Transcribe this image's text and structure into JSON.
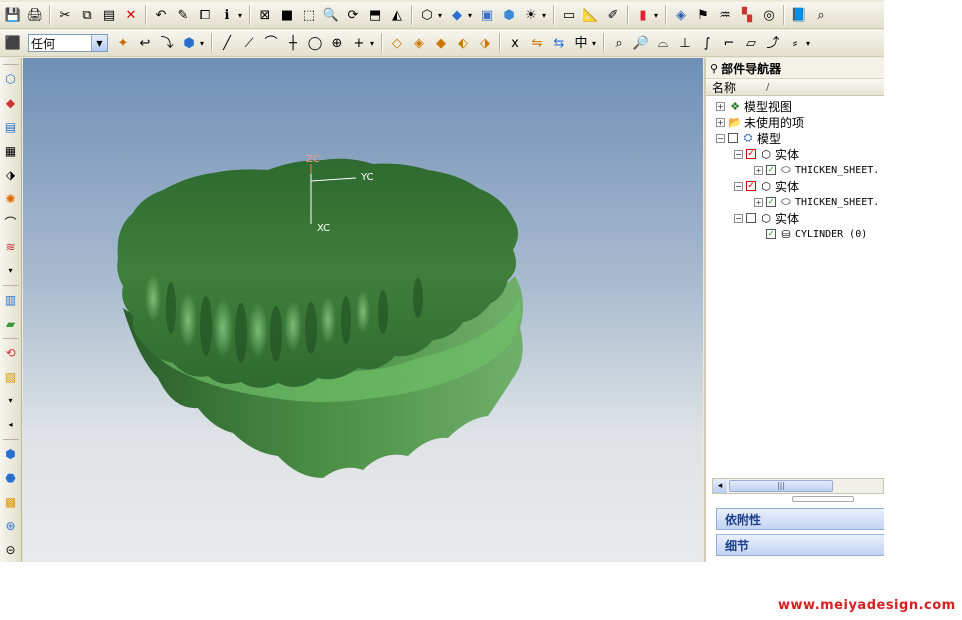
{
  "toolbar": {
    "row1_icons": [
      "save-icon",
      "print-icon",
      "cut-icon",
      "copy-icon",
      "paste-icon",
      "delete-icon",
      "undo-icon",
      "edit-icon",
      "object-icon",
      "info-icon",
      "fit-icon",
      "shade-icon",
      "zoom-box-icon",
      "zoom-icon",
      "rotate-icon",
      "pan-icon",
      "view-icon",
      "cube-view-icon",
      "solid-view-icon",
      "render-icon",
      "shaded-cube-icon",
      "light-icon",
      "ruler-icon",
      "measure-icon",
      "analysis-icon",
      "color-icon",
      "layer-icon",
      "flag-icon",
      "surface-icon",
      "layout-icon",
      "zoom-edge-icon"
    ],
    "selection_filter": "任何",
    "row2_icons": [
      "snap-icon",
      "arrow-icon",
      "feature-icon",
      "shape-icon",
      "line-icon",
      "diagonal-icon",
      "curve-icon",
      "cross-icon",
      "circle-icon",
      "target-icon",
      "plus-icon",
      "face-icon",
      "face2-icon",
      "face3-icon",
      "face4-icon",
      "face5-icon",
      "xform-icon",
      "mirror-icon",
      "replace-icon",
      "axis-icon",
      "search-icon",
      "search2-icon",
      "arc-icon",
      "perpendicular-icon",
      "spline-icon",
      "corner-icon",
      "rect-icon",
      "trim-icon",
      "extend-icon"
    ]
  },
  "left_toolbar": {
    "icons": [
      "sketch-icon",
      "feature-icon",
      "extrude-icon",
      "layer-icon",
      "measure-icon",
      "color-icon",
      "curve-icon",
      "wave-icon",
      "dropdown-icon",
      "solid-icon",
      "green-icon",
      "tube-icon",
      "box-icon",
      "dropdown-icon",
      "shape-icon",
      "shape2-icon",
      "shape3-icon",
      "shape4-icon",
      "shape5-icon"
    ]
  },
  "viewport": {
    "axes": {
      "z": "ZC",
      "y": "YC",
      "x": "XC"
    },
    "colors": {
      "model": "#3f7f3a",
      "model_light": "#5fa659",
      "model_dark": "#25552a"
    }
  },
  "navigator": {
    "title": "部件导航器",
    "column_name": "名称",
    "column_sort": "/",
    "tree": [
      {
        "label": "模型视图",
        "expander": "+",
        "icon": "model-view-icon",
        "check": "none",
        "indent": 0
      },
      {
        "label": "未使用的项",
        "expander": "+",
        "icon": "folder-icon",
        "check": "none",
        "indent": 0
      },
      {
        "label": "模型",
        "expander": "−",
        "icon": "model-icon",
        "check": "empty",
        "indent": 0
      },
      {
        "label": "实体",
        "expander": "−",
        "icon": "solid-body-icon",
        "check": "red",
        "indent": 1
      },
      {
        "label": "THICKEN_SHEET.",
        "expander": "+",
        "icon": "sheet-icon",
        "check": "green",
        "indent": 2
      },
      {
        "label": "实体",
        "expander": "−",
        "icon": "solid-body-icon",
        "check": "red",
        "indent": 1
      },
      {
        "label": "THICKEN_SHEET.",
        "expander": "+",
        "icon": "sheet-icon",
        "check": "green",
        "indent": 2
      },
      {
        "label": "实体",
        "expander": "−",
        "icon": "solid-body-icon",
        "check": "empty",
        "indent": 1
      },
      {
        "label": "CYLINDER (0)",
        "expander": "",
        "icon": "cylinder-icon",
        "check": "green",
        "indent": 2
      }
    ],
    "panels": [
      "依附性",
      "细节"
    ]
  },
  "watermark": "www.meiyadesign.com"
}
